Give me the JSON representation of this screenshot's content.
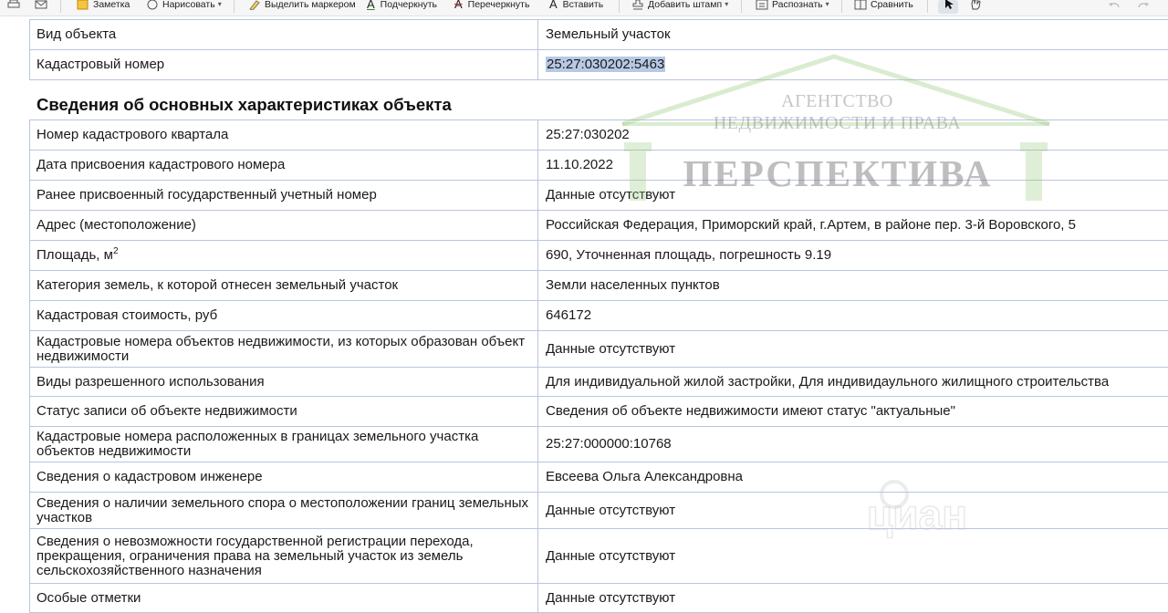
{
  "toolbar": {
    "note": "Заметка",
    "draw": "Нарисовать",
    "highlighter": "Выделить маркером",
    "underline": "Подчеркнуть",
    "strikethrough": "Перечеркнуть",
    "insert": "Вставить",
    "stamp": "Добавить штамп",
    "recognize": "Распознать",
    "compare": "Сравнить"
  },
  "top_table": [
    {
      "label": "Вид объекта",
      "value": "Земельный участок"
    },
    {
      "label": "Кадастровый номер",
      "value": "25:27:030202:5463"
    }
  ],
  "section_title": "Сведения об основных характеристиках объекта",
  "area_unit_sup": "2",
  "rows": [
    {
      "label": "Номер кадастрового квартала",
      "value": "25:27:030202"
    },
    {
      "label": "Дата присвоения кадастрового номера",
      "value": "11.10.2022"
    },
    {
      "label": "Ранее присвоенный государственный учетный номер",
      "value": "Данные отсутствуют"
    },
    {
      "label": "Адрес (местоположение)",
      "value": "Российская Федерация, Приморский край, г.Артем, в районе пер. 3-й Воровского, 5"
    },
    {
      "label": "Площадь, м",
      "value": "690, Уточненная площадь, погрешность 9.19"
    },
    {
      "label": "Категория земель, к которой отнесен земельный участок",
      "value": "Земли населенных пунктов"
    },
    {
      "label": "Кадастровая стоимость, руб",
      "value": "646172"
    },
    {
      "label": "Кадастровые номера объектов недвижимости, из которых образован объект недвижимости",
      "value": "Данные отсутствуют"
    },
    {
      "label": "Виды разрешенного использования",
      "value": "Для индивидуальной жилой застройки, Для индивидаульного жилищного строительства"
    },
    {
      "label": "Статус записи об объекте недвижимости",
      "value": "Сведения об объекте недвижимости имеют статус \"актуальные\""
    },
    {
      "label": "Кадастровые номера расположенных в границах земельного участка объектов недвижимости",
      "value": "25:27:000000:10768"
    },
    {
      "label": "Сведения о кадастровом инженере",
      "value": "Евсеева Ольга Александровна"
    },
    {
      "label": "Сведения о наличии земельного спора о местоположении границ земельных участков",
      "value": "Данные отсутствуют"
    },
    {
      "label": "Сведения о невозможности государственной регистрации перехода, прекращения, ограничения права на земельный участок из земель сельскохозяйственного назначения",
      "value": "Данные отсутствуют"
    },
    {
      "label": "Особые отметки",
      "value": "Данные отсутствуют"
    }
  ],
  "watermark": {
    "line1": "АГЕНТСТВО",
    "line2": "НЕДВИЖИМОСТИ И ПРАВА",
    "brand": "ПЕРСПЕКТИВА",
    "cian": "циан"
  }
}
